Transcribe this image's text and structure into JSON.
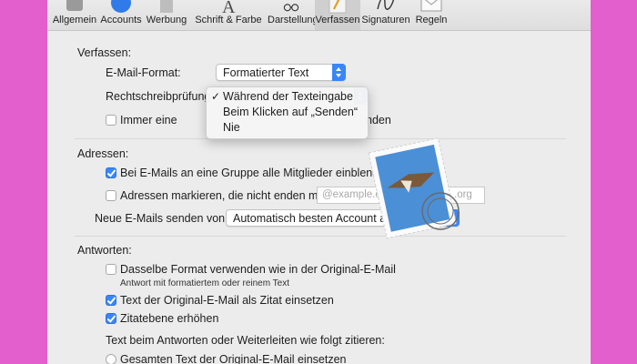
{
  "toolbar": {
    "items": [
      {
        "label": "Allgemein",
        "icon": "switch-icon"
      },
      {
        "label": "Accounts",
        "icon": "at-sign-icon"
      },
      {
        "label": "Werbung",
        "icon": "trash-icon"
      },
      {
        "label": "Schrift & Farbe",
        "icon": "font-icon"
      },
      {
        "label": "Darstellung",
        "icon": "glasses-icon"
      },
      {
        "label": "Verfassen",
        "icon": "pencil-icon"
      },
      {
        "label": "Signaturen",
        "icon": "signature-icon"
      },
      {
        "label": "Regeln",
        "icon": "envelope-rules-icon"
      }
    ],
    "active": "Verfassen"
  },
  "compose": {
    "section_label": "Verfassen:",
    "format_label": "E-Mail-Format:",
    "format_value": "Formatierter Text",
    "spelling_label": "Rechtschreibprüfung",
    "always_label_start": "Immer eine",
    "always_label_end": "nden"
  },
  "spelling_menu": {
    "check_mark": "✓",
    "options": [
      "Während der Texteingabe",
      "Beim Klicken auf „Senden“",
      "Nie"
    ],
    "selected": 0
  },
  "addresses": {
    "section_label": "Adressen:",
    "group_label": "Bei E-Mails an eine Gruppe alle Mitglieder einblenden",
    "group_checked": true,
    "mark_label": "Adressen markieren, die nicht enden mit",
    "mark_checked": false,
    "mark_placeholder_start": "@example.c",
    "mark_placeholder_end": ".org",
    "send_from_label": "Neue E-Mails senden von:",
    "send_from_value": "Automatisch besten Account au"
  },
  "replies": {
    "section_label": "Antworten:",
    "same_format_label": "Dasselbe Format verwenden wie in der Original-E-Mail",
    "same_format_checked": false,
    "same_format_hint": "Antwort mit formatiertem oder reinem Text",
    "quote_label": "Text der Original-E-Mail als Zitat einsetzen",
    "quote_checked": true,
    "indent_label": "Zitatebene erhöhen",
    "indent_checked": true,
    "quote_mode_label": "Text beim Antworten oder Weiterleiten wie folgt zitieren:",
    "radio_all_label": "Gesamten Text der Original-E-Mail einsetzen"
  },
  "colors": {
    "background": "#e35fcd",
    "accent": "#3b86f7"
  }
}
